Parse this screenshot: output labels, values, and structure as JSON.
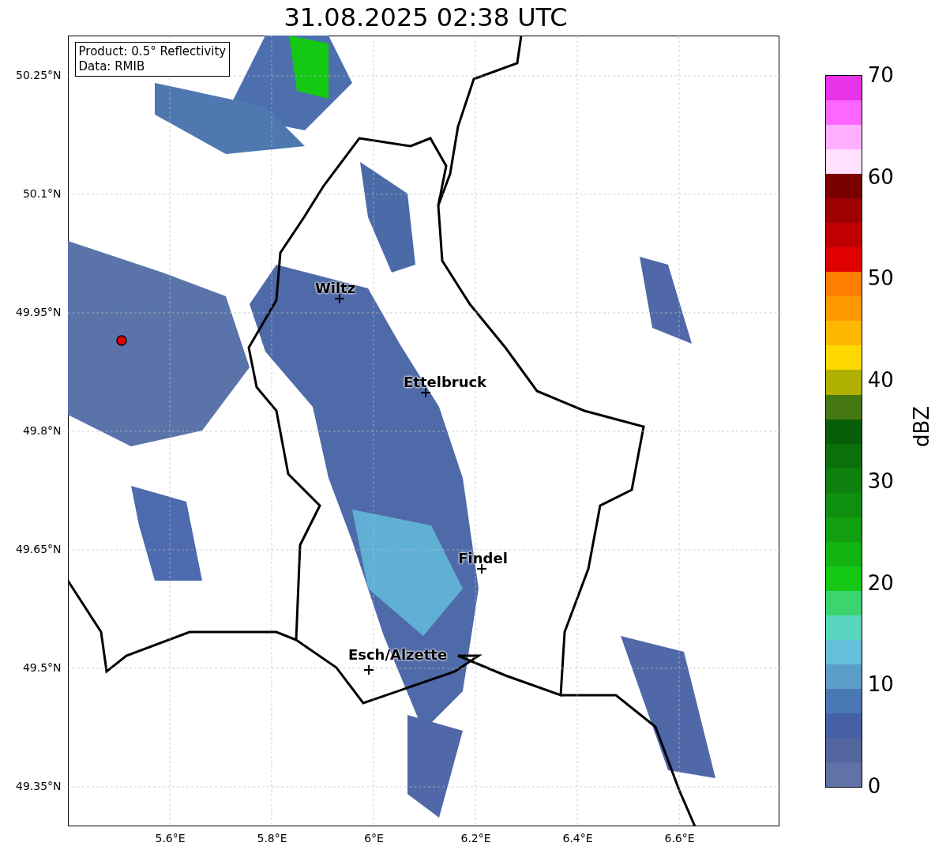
{
  "title": "31.08.2025 02:38 UTC",
  "info_box": [
    "Product: 0.5° Reflectivity",
    "Data: RMIB"
  ],
  "y_ticks": [
    "50.25°N",
    "50.1°N",
    "49.95°N",
    "49.8°N",
    "49.65°N",
    "49.5°N",
    "49.35°N"
  ],
  "x_ticks": [
    "5.6°E",
    "5.8°E",
    "6°E",
    "6.2°E",
    "6.4°E",
    "6.6°E"
  ],
  "cities": [
    "Wiltz",
    "Ettelbruck",
    "Findel",
    "Esch/Alzette"
  ],
  "colorbar": {
    "label": "dBZ",
    "ticks": [
      "70",
      "60",
      "50",
      "40",
      "30",
      "20",
      "10",
      "0"
    ],
    "bins": [
      {
        "color": "#6272a8"
      },
      {
        "color": "#53669e"
      },
      {
        "color": "#4560a5"
      },
      {
        "color": "#4a78b4"
      },
      {
        "color": "#5a9ec8"
      },
      {
        "color": "#64c0dc"
      },
      {
        "color": "#5ad6c0"
      },
      {
        "color": "#3cd46e"
      },
      {
        "color": "#14c814"
      },
      {
        "color": "#12b412"
      },
      {
        "color": "#12a012"
      },
      {
        "color": "#0f8f0f"
      },
      {
        "color": "#0d800d"
      },
      {
        "color": "#0a700a"
      },
      {
        "color": "#085e08"
      },
      {
        "color": "#457810"
      },
      {
        "color": "#b0b000"
      },
      {
        "color": "#ffd800"
      },
      {
        "color": "#ffb700"
      },
      {
        "color": "#ff9900"
      },
      {
        "color": "#ff7f00"
      },
      {
        "color": "#e00000"
      },
      {
        "color": "#c00000"
      },
      {
        "color": "#9c0000"
      },
      {
        "color": "#7a0000"
      },
      {
        "color": "#ffe0ff"
      },
      {
        "color": "#ffb0ff"
      },
      {
        "color": "#ff66ff"
      },
      {
        "color": "#e833e8"
      }
    ]
  }
}
